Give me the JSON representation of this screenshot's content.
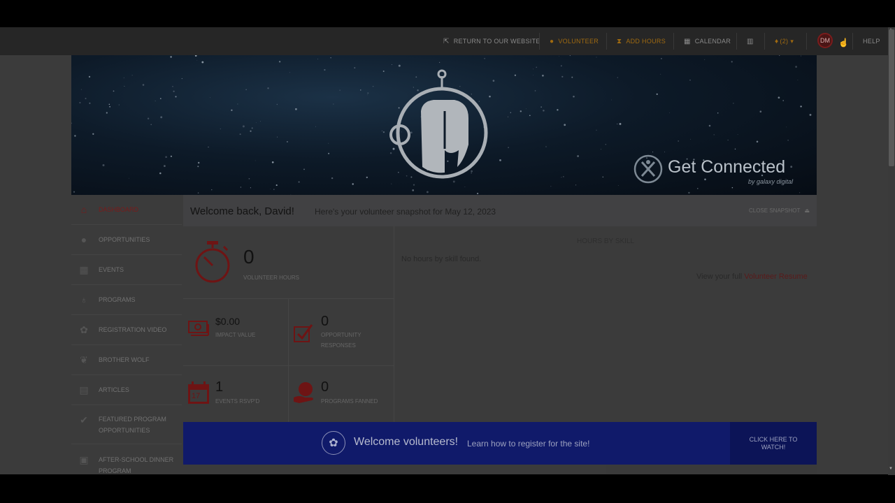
{
  "topbar": {
    "return_website": "RETURN TO OUR WEBSITE",
    "volunteer": "VOLUNTEER",
    "add_hours": "ADD HOURS",
    "calendar": "CALENDAR",
    "notifications_count": "(2)",
    "avatar_initials": "DM",
    "help": "HELP"
  },
  "banner": {
    "brand_name": "Get Connected",
    "brand_sub": "by galaxy digital"
  },
  "sidebar": {
    "items": [
      {
        "label": "DASHBOARD",
        "icon": "home-icon"
      },
      {
        "label": "OPPORTUNITIES",
        "icon": "check-circle-icon"
      },
      {
        "label": "EVENTS",
        "icon": "calendar-icon"
      },
      {
        "label": "PROGRAMS",
        "icon": "hand-globe-icon"
      },
      {
        "label": "REGISTRATION VIDEO",
        "icon": "gear-flower-icon"
      },
      {
        "label": "BROTHER WOLF",
        "icon": "paw-icon"
      },
      {
        "label": "ARTICLES",
        "icon": "articles-icon"
      },
      {
        "label": "FEATURED PROGRAM OPPORTUNITIES",
        "icon": "checkmark-icon"
      },
      {
        "label": "AFTER-SCHOOL DINNER PROGRAM",
        "icon": "bus-icon"
      }
    ]
  },
  "welcome": {
    "title": "Welcome back, David!",
    "subtitle": "Here's your volunteer snapshot for May 12, 2023",
    "close_label": "CLOSE SNAPSHOT"
  },
  "stats": {
    "volunteer_hours": {
      "value": "0",
      "label": "VOLUNTEER HOURS"
    },
    "impact_value": {
      "value": "$0.00",
      "label": "IMPACT VALUE"
    },
    "opportunity_responses": {
      "value": "0",
      "label": "OPPORTUNITY RESPONSES"
    },
    "events_rsvpd": {
      "value": "1",
      "label": "EVENTS RSVP'D",
      "icon_text": "17"
    },
    "programs_fanned": {
      "value": "0",
      "label": "PROGRAMS FANNED"
    }
  },
  "skills": {
    "title": "HOURS BY SKILL",
    "empty": "No hours by skill found.",
    "resume_prefix": "View your full ",
    "resume_link": "Volunteer Resume"
  },
  "promo": {
    "title": "Welcome volunteers!",
    "subtitle": "Learn how to register for the site!",
    "button": "CLICK HERE TO WATCH!"
  },
  "colors": {
    "accent": "#7a1a1a",
    "orange": "#a06a10",
    "promo_blue": "#101a6a",
    "topbar": "#262626"
  }
}
